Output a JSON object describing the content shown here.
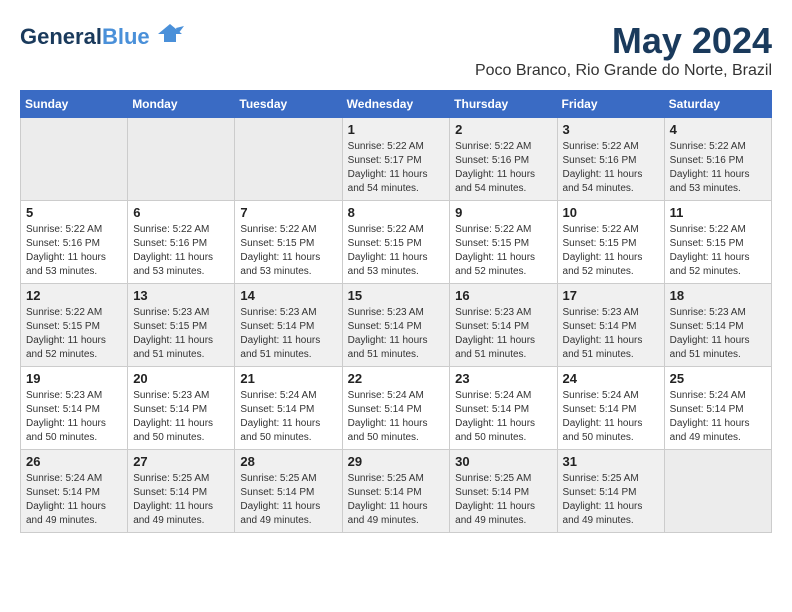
{
  "logo": {
    "text1": "General",
    "text2": "Blue"
  },
  "title": "May 2024",
  "location": "Poco Branco, Rio Grande do Norte, Brazil",
  "headers": [
    "Sunday",
    "Monday",
    "Tuesday",
    "Wednesday",
    "Thursday",
    "Friday",
    "Saturday"
  ],
  "weeks": [
    [
      {
        "day": "",
        "empty": true
      },
      {
        "day": "",
        "empty": true
      },
      {
        "day": "",
        "empty": true
      },
      {
        "day": "1",
        "sunrise": "5:22 AM",
        "sunset": "5:17 PM",
        "daylight": "11 hours and 54 minutes."
      },
      {
        "day": "2",
        "sunrise": "5:22 AM",
        "sunset": "5:16 PM",
        "daylight": "11 hours and 54 minutes."
      },
      {
        "day": "3",
        "sunrise": "5:22 AM",
        "sunset": "5:16 PM",
        "daylight": "11 hours and 54 minutes."
      },
      {
        "day": "4",
        "sunrise": "5:22 AM",
        "sunset": "5:16 PM",
        "daylight": "11 hours and 53 minutes."
      }
    ],
    [
      {
        "day": "5",
        "sunrise": "5:22 AM",
        "sunset": "5:16 PM",
        "daylight": "11 hours and 53 minutes."
      },
      {
        "day": "6",
        "sunrise": "5:22 AM",
        "sunset": "5:16 PM",
        "daylight": "11 hours and 53 minutes."
      },
      {
        "day": "7",
        "sunrise": "5:22 AM",
        "sunset": "5:15 PM",
        "daylight": "11 hours and 53 minutes."
      },
      {
        "day": "8",
        "sunrise": "5:22 AM",
        "sunset": "5:15 PM",
        "daylight": "11 hours and 53 minutes."
      },
      {
        "day": "9",
        "sunrise": "5:22 AM",
        "sunset": "5:15 PM",
        "daylight": "11 hours and 52 minutes."
      },
      {
        "day": "10",
        "sunrise": "5:22 AM",
        "sunset": "5:15 PM",
        "daylight": "11 hours and 52 minutes."
      },
      {
        "day": "11",
        "sunrise": "5:22 AM",
        "sunset": "5:15 PM",
        "daylight": "11 hours and 52 minutes."
      }
    ],
    [
      {
        "day": "12",
        "sunrise": "5:22 AM",
        "sunset": "5:15 PM",
        "daylight": "11 hours and 52 minutes."
      },
      {
        "day": "13",
        "sunrise": "5:23 AM",
        "sunset": "5:15 PM",
        "daylight": "11 hours and 51 minutes."
      },
      {
        "day": "14",
        "sunrise": "5:23 AM",
        "sunset": "5:14 PM",
        "daylight": "11 hours and 51 minutes."
      },
      {
        "day": "15",
        "sunrise": "5:23 AM",
        "sunset": "5:14 PM",
        "daylight": "11 hours and 51 minutes."
      },
      {
        "day": "16",
        "sunrise": "5:23 AM",
        "sunset": "5:14 PM",
        "daylight": "11 hours and 51 minutes."
      },
      {
        "day": "17",
        "sunrise": "5:23 AM",
        "sunset": "5:14 PM",
        "daylight": "11 hours and 51 minutes."
      },
      {
        "day": "18",
        "sunrise": "5:23 AM",
        "sunset": "5:14 PM",
        "daylight": "11 hours and 51 minutes."
      }
    ],
    [
      {
        "day": "19",
        "sunrise": "5:23 AM",
        "sunset": "5:14 PM",
        "daylight": "11 hours and 50 minutes."
      },
      {
        "day": "20",
        "sunrise": "5:23 AM",
        "sunset": "5:14 PM",
        "daylight": "11 hours and 50 minutes."
      },
      {
        "day": "21",
        "sunrise": "5:24 AM",
        "sunset": "5:14 PM",
        "daylight": "11 hours and 50 minutes."
      },
      {
        "day": "22",
        "sunrise": "5:24 AM",
        "sunset": "5:14 PM",
        "daylight": "11 hours and 50 minutes."
      },
      {
        "day": "23",
        "sunrise": "5:24 AM",
        "sunset": "5:14 PM",
        "daylight": "11 hours and 50 minutes."
      },
      {
        "day": "24",
        "sunrise": "5:24 AM",
        "sunset": "5:14 PM",
        "daylight": "11 hours and 50 minutes."
      },
      {
        "day": "25",
        "sunrise": "5:24 AM",
        "sunset": "5:14 PM",
        "daylight": "11 hours and 49 minutes."
      }
    ],
    [
      {
        "day": "26",
        "sunrise": "5:24 AM",
        "sunset": "5:14 PM",
        "daylight": "11 hours and 49 minutes."
      },
      {
        "day": "27",
        "sunrise": "5:25 AM",
        "sunset": "5:14 PM",
        "daylight": "11 hours and 49 minutes."
      },
      {
        "day": "28",
        "sunrise": "5:25 AM",
        "sunset": "5:14 PM",
        "daylight": "11 hours and 49 minutes."
      },
      {
        "day": "29",
        "sunrise": "5:25 AM",
        "sunset": "5:14 PM",
        "daylight": "11 hours and 49 minutes."
      },
      {
        "day": "30",
        "sunrise": "5:25 AM",
        "sunset": "5:14 PM",
        "daylight": "11 hours and 49 minutes."
      },
      {
        "day": "31",
        "sunrise": "5:25 AM",
        "sunset": "5:14 PM",
        "daylight": "11 hours and 49 minutes."
      },
      {
        "day": "",
        "empty": true
      }
    ]
  ],
  "labels": {
    "sunrise": "Sunrise:",
    "sunset": "Sunset:",
    "daylight": "Daylight:"
  }
}
